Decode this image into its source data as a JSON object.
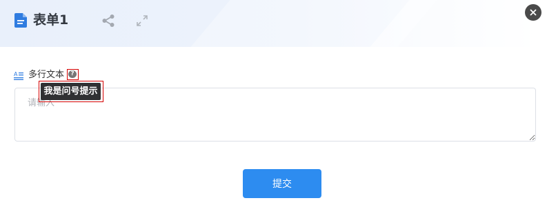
{
  "header": {
    "title": "表单1",
    "icons": {
      "doc": "document-icon",
      "share": "share-icon",
      "expand": "expand-icon",
      "close": "close-icon"
    }
  },
  "field": {
    "icon": "multiline-text-icon",
    "label": "多行文本",
    "help_mark": "?",
    "tooltip": "我是问号提示",
    "placeholder": "请输入",
    "value": ""
  },
  "actions": {
    "submit_label": "提交"
  },
  "colors": {
    "accent": "#2d8cf0",
    "doc_icon": "#2f7ce0",
    "tooltip_bg": "#303133",
    "highlight": "#d40000",
    "close_bg": "#4a4a4a"
  }
}
